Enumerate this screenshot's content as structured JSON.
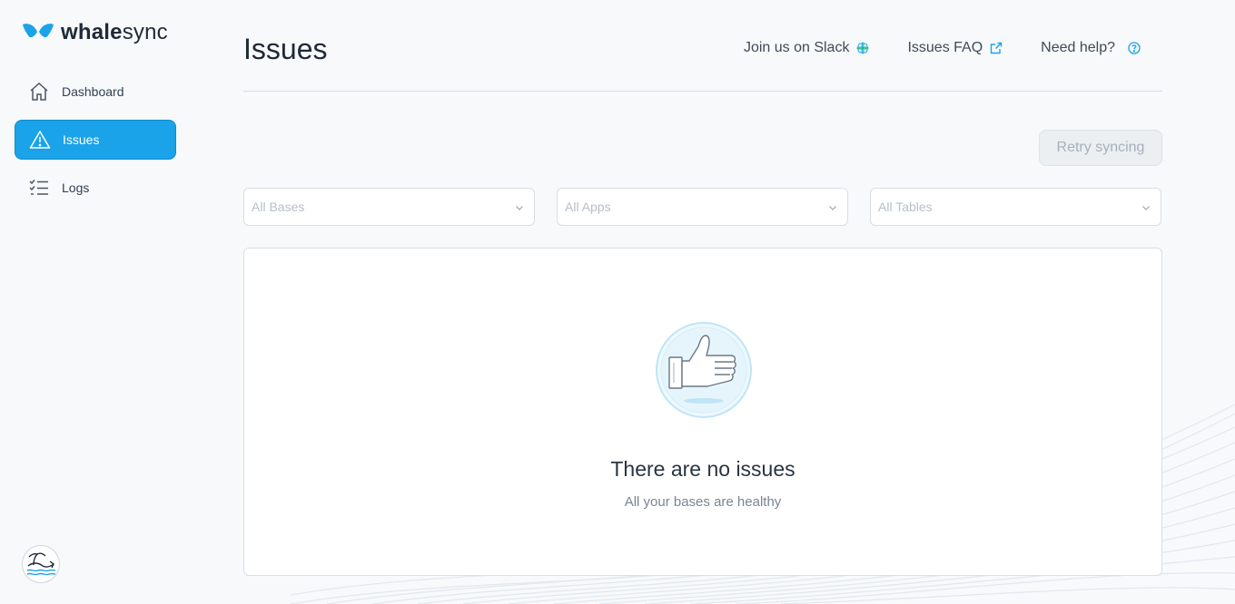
{
  "brand": {
    "name_bold": "whale",
    "name_rest": "sync",
    "colors": {
      "accent": "#1aa3e8",
      "logo": "#1aa3e8"
    }
  },
  "sidebar": {
    "items": [
      {
        "label": "Dashboard",
        "icon": "home-icon",
        "active": false
      },
      {
        "label": "Issues",
        "icon": "warning-icon",
        "active": true
      },
      {
        "label": "Logs",
        "icon": "checklist-icon",
        "active": false
      }
    ],
    "avatar_icon": "whale-island-avatar"
  },
  "header": {
    "title": "Issues",
    "links": [
      {
        "label": "Join us on Slack",
        "icon": "slack-icon"
      },
      {
        "label": "Issues FAQ",
        "icon": "external-link-icon"
      },
      {
        "label": "Need help?",
        "icon": "help-circle-icon"
      }
    ]
  },
  "toolbar": {
    "retry_label": "Retry syncing"
  },
  "filters": [
    {
      "placeholder": "All Bases",
      "icon": "chevron-down-icon"
    },
    {
      "placeholder": "All Apps",
      "icon": "chevron-down-icon"
    },
    {
      "placeholder": "All Tables",
      "icon": "chevron-down-icon"
    }
  ],
  "empty_state": {
    "icon": "thumbs-up-icon",
    "title": "There are no issues",
    "subtitle": "All your bases are healthy"
  }
}
